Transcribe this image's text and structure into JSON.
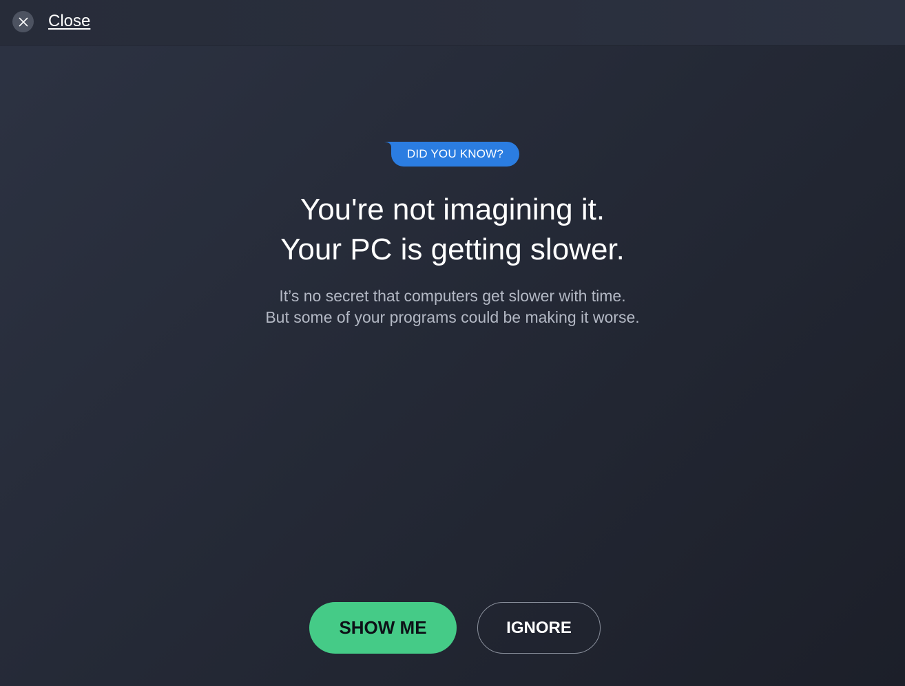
{
  "topbar": {
    "close_label": "Close",
    "close_icon": "close-icon"
  },
  "badge": {
    "label": "DID YOU KNOW?",
    "color": "#2b7de1"
  },
  "headline": {
    "line1": "You're not imagining it.",
    "line2": "Your PC is getting slower."
  },
  "subtext": {
    "line1": "It’s no secret that computers get slower with time.",
    "line2": "But some of your programs could be making it worse."
  },
  "actions": {
    "primary_label": "SHOW ME",
    "primary_color": "#45cb87",
    "secondary_label": "IGNORE"
  }
}
